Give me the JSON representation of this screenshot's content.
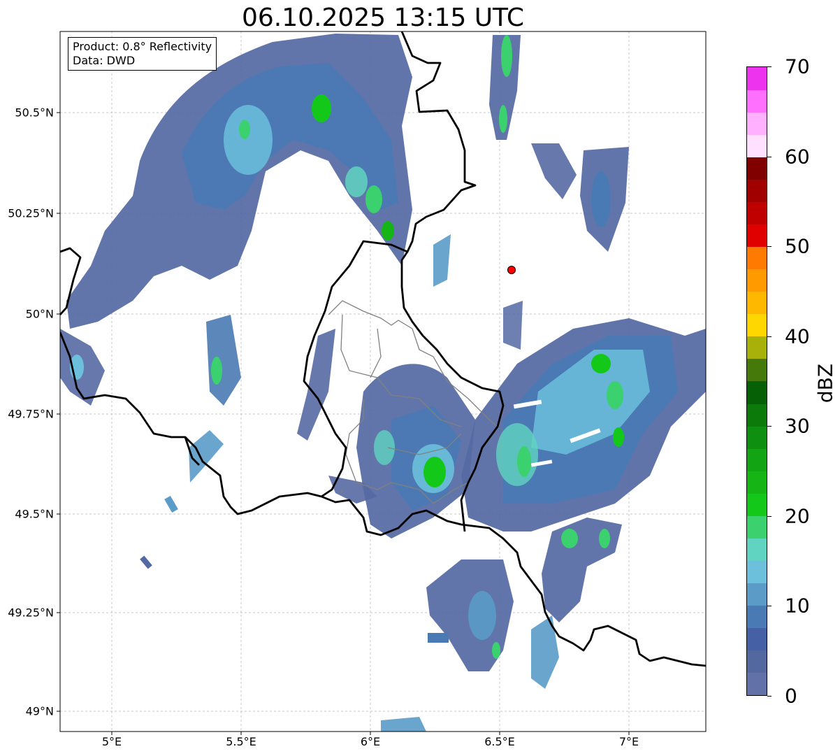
{
  "title": "06.10.2025 13:15 UTC",
  "info": {
    "product": "Product: 0.8° Reflectivity",
    "source": "Data: DWD"
  },
  "axes": {
    "lon_ticks": [
      "5°E",
      "5.5°E",
      "6°E",
      "6.5°E",
      "7°E"
    ],
    "lat_ticks": [
      "50.5°N",
      "50.25°N",
      "50°N",
      "49.75°N",
      "49.5°N",
      "49.25°N",
      "49°N"
    ]
  },
  "colorbar": {
    "unit": "dBZ",
    "min": 0,
    "max": 70,
    "tick_labels": [
      "0",
      "10",
      "20",
      "30",
      "40",
      "50",
      "60",
      "70"
    ],
    "colors": [
      "#6272a8",
      "#53689f",
      "#4560a4",
      "#4a7ab4",
      "#5a9bc8",
      "#6cc0dc",
      "#60d4c0",
      "#3ad16e",
      "#14c81a",
      "#14b514",
      "#12a412",
      "#0f8f0f",
      "#0b7a0b",
      "#066006",
      "#457a0a",
      "#a8b00a",
      "#ffd700",
      "#ffb800",
      "#ff9a00",
      "#ff7a00",
      "#e00000",
      "#c00000",
      "#a00000",
      "#800000",
      "#ffe0ff",
      "#ffb0ff",
      "#ff70ff",
      "#ee33ee"
    ]
  },
  "markers": {
    "radar_site_color": "#ff0000"
  }
}
